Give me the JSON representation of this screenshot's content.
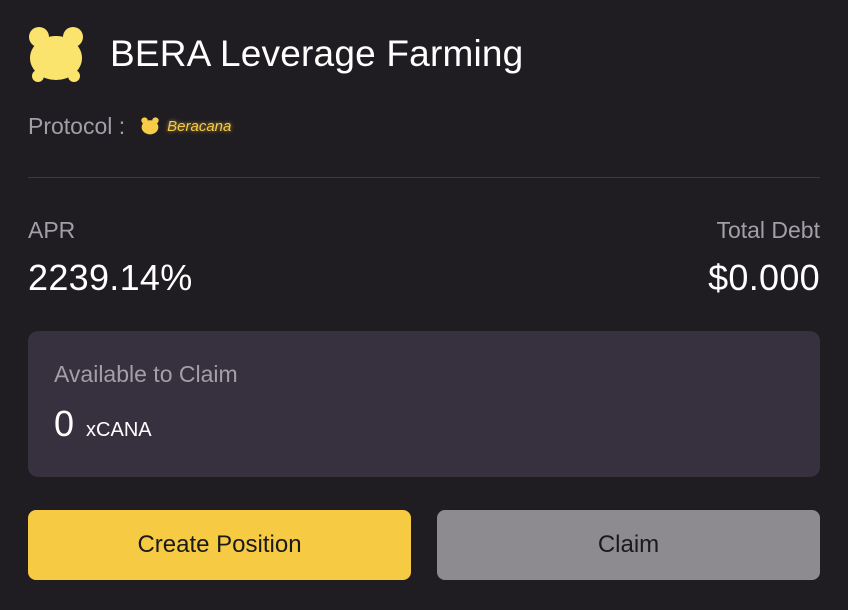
{
  "header": {
    "logo_icon": "bear-head-icon",
    "title": "BERA Leverage Farming"
  },
  "protocol": {
    "label": "Protocol :",
    "icon": "bear-head-icon",
    "name": "Beracana"
  },
  "stats": {
    "apr_label": "APR",
    "apr_value": "2239.14%",
    "debt_label": "Total Debt",
    "debt_value": "$0.000"
  },
  "claim": {
    "label": "Available to Claim",
    "amount": "0",
    "unit": "xCANA"
  },
  "buttons": {
    "create_label": "Create Position",
    "claim_label": "Claim"
  },
  "colors": {
    "background": "#1f1c22",
    "accent_yellow": "#f7ca44",
    "claim_box": "#37313f",
    "disabled_button": "#8d8b90",
    "muted_text": "#a29fa6"
  }
}
